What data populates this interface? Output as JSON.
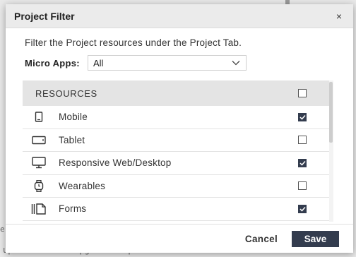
{
  "background": {
    "bottom_text": "upre-uata. No upgrade required.",
    "left_fragment": "e"
  },
  "modal": {
    "title": "Project Filter",
    "close_symbol": "×",
    "description": "Filter the Project resources under the Project Tab.",
    "micro_apps": {
      "label": "Micro Apps:",
      "selected": "All"
    },
    "table": {
      "header_label": "RESOURCES",
      "header_checked": false,
      "rows": [
        {
          "label": "Mobile",
          "icon": "mobile-icon",
          "checked": true
        },
        {
          "label": "Tablet",
          "icon": "tablet-icon",
          "checked": false
        },
        {
          "label": "Responsive Web/Desktop",
          "icon": "desktop-monitor-icon",
          "checked": true
        },
        {
          "label": "Wearables",
          "icon": "smartwatch-icon",
          "checked": false
        },
        {
          "label": "Forms",
          "icon": "forms-icon",
          "checked": true
        }
      ]
    },
    "footer": {
      "cancel_label": "Cancel",
      "save_label": "Save"
    }
  },
  "colors": {
    "primary": "#333c4e",
    "header_bg": "#ebebeb",
    "table_header_bg": "#e4e4e4"
  }
}
